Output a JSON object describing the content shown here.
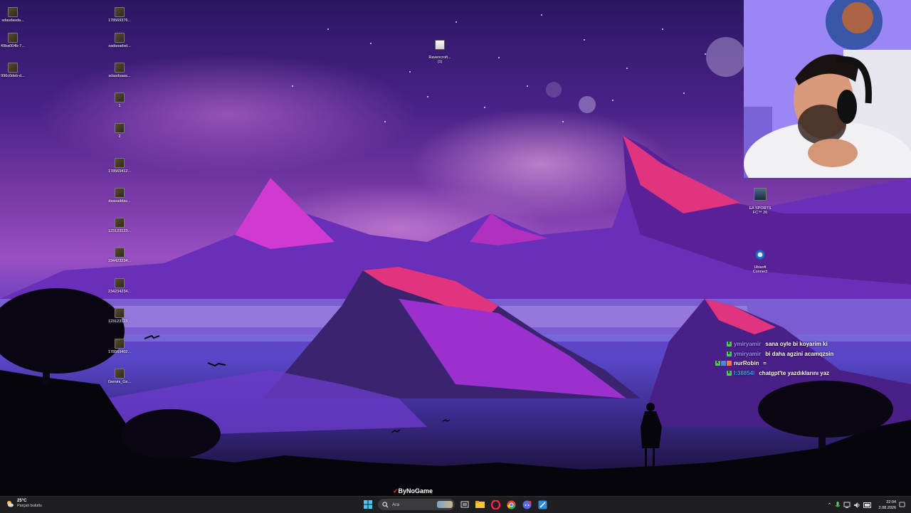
{
  "desktop": {
    "icons": [
      {
        "label": "sdasdasda...",
        "type": "file"
      },
      {
        "label": "49ba004b-7...",
        "type": "file"
      },
      {
        "label": "996c0deb-d...",
        "type": "file"
      },
      {
        "label": "178569376...",
        "type": "file"
      },
      {
        "label": "sadasadsd...",
        "type": "file"
      },
      {
        "label": "sdasdsaas...",
        "type": "file"
      },
      {
        "label": "1",
        "type": "file"
      },
      {
        "label": "2",
        "type": "file"
      },
      {
        "label": "178569412...",
        "type": "file"
      },
      {
        "label": "dsasaddas...",
        "type": "file"
      },
      {
        "label": "123123123...",
        "type": "file"
      },
      {
        "label": "234423234...",
        "type": "file"
      },
      {
        "label": "234234234...",
        "type": "file"
      },
      {
        "label": "123123123...",
        "type": "file"
      },
      {
        "label": "178569402...",
        "type": "file"
      },
      {
        "label": "Gemini_Ge...",
        "type": "file"
      },
      {
        "label": "Ravencroft...\n(1)",
        "type": "file"
      },
      {
        "label": "EA SPORTS\nFC™ 26",
        "type": "game"
      },
      {
        "label": "Ubisoft\nConnect",
        "type": "app"
      }
    ]
  },
  "chat": {
    "messages": [
      {
        "user": "ymiryamir",
        "text": "sana oyle bi koyarim ki",
        "user_color": "#9b8cff",
        "badges": [
          "#4bd14b"
        ]
      },
      {
        "user": "ymiryamir",
        "text": "bi daha agzini acamqzsin",
        "user_color": "#9b8cff",
        "badges": [
          "#4bd14b"
        ]
      },
      {
        "user": "nurRobin",
        "text": "≈",
        "user_color": "#ffffff",
        "badges": [
          "#4bd14b",
          "#3a8dff",
          "#ff7a2a"
        ]
      },
      {
        "user": "l:38854l",
        "text": "chatgpt'te yazdıklarını yaz",
        "user_color": "#3aa0ff",
        "badges": [
          "#4bd14b"
        ]
      }
    ]
  },
  "watermark": "ByNoGame",
  "taskbar": {
    "weather_temp": "25°C",
    "weather_desc": "Parçalı bulutlu",
    "search_placeholder": "Ara",
    "time": "22:04",
    "date": "2.08.2026",
    "pinned_icons": [
      "windows-start-icon",
      "task-view-icon",
      "file-explorer-icon",
      "opera-gx-icon",
      "chrome-icon",
      "discord-icon",
      "app-icon"
    ],
    "tray_icons": [
      "chevron-up-icon",
      "microphone-icon",
      "network-icon",
      "volume-icon",
      "battery-icon",
      "notification-icon"
    ]
  },
  "colors": {
    "taskbar_bg": "#1f1f22",
    "chat_badge_green": "#4bd14b"
  }
}
